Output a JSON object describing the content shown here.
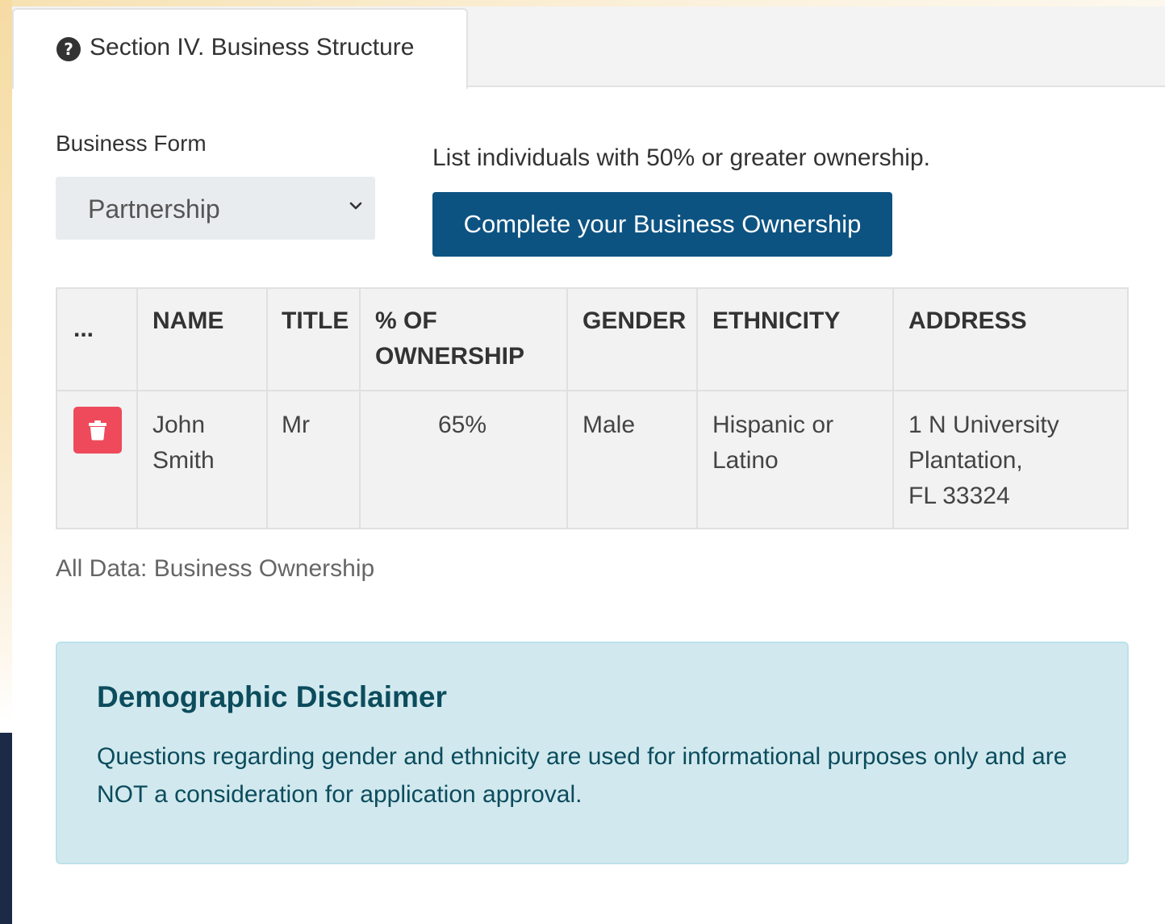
{
  "tab": {
    "icon": "question-circle-icon",
    "label": "Section IV. Business Structure"
  },
  "form": {
    "business_form_label": "Business Form",
    "business_form_value": "Partnership",
    "hint": "List individuals with 50% or greater ownership.",
    "button_label": "Complete your Business Ownership"
  },
  "table": {
    "headers": {
      "actions": "...",
      "name": "NAME",
      "title": "TITLE",
      "ownership_line1": "% OF",
      "ownership_line2": "OWNERSHIP",
      "gender": "GENDER",
      "ethnicity": "ETHNICITY",
      "address": "ADDRESS"
    },
    "rows": [
      {
        "delete_icon": "trash-icon",
        "name_first": "John",
        "name_last": "Smith",
        "title": "Mr",
        "ownership": "65%",
        "gender": "Male",
        "ethnicity_line1": "Hispanic or",
        "ethnicity_line2": "Latino",
        "address_line1": "1 N University",
        "address_line2": "Plantation,",
        "address_line3": "FL 33324"
      }
    ]
  },
  "footnote": "All Data: Business Ownership",
  "disclaimer": {
    "title": "Demographic Disclaimer",
    "body": "Questions regarding gender and ethnicity are used for informational purposes only and are NOT a consideration for application approval."
  },
  "colors": {
    "primary_button": "#0d5382",
    "delete_button": "#ee4a5c",
    "disclaimer_bg": "#d1e9ee",
    "disclaimer_text": "#0c4c5d"
  }
}
